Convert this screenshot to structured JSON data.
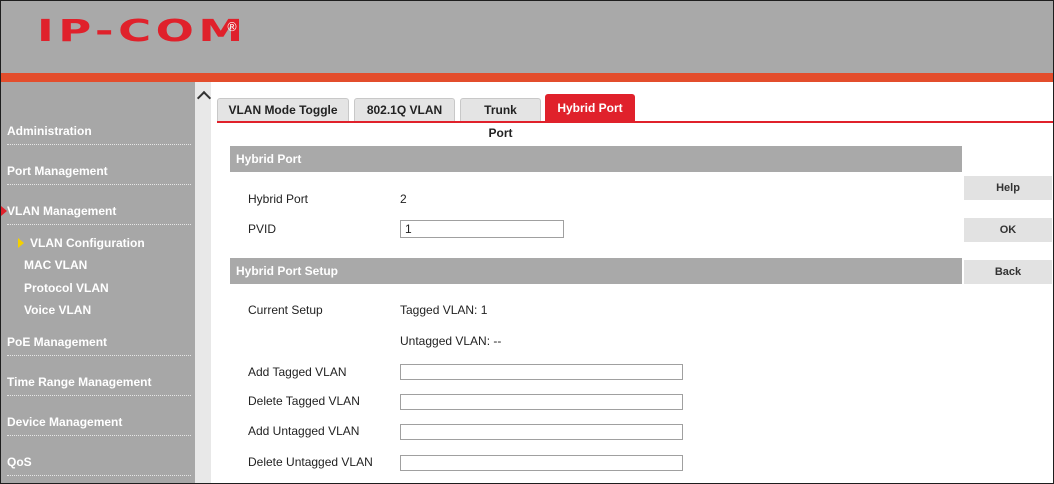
{
  "brand": {
    "logo": "IP-COM",
    "reg": "®"
  },
  "colors": {
    "accent": "#e0212b",
    "header_bg": "#a9a9a9",
    "sidebar_bg": "#a7a7a7",
    "stripe": "#e34d2c"
  },
  "sidebar": {
    "items": [
      {
        "label": "Administration"
      },
      {
        "label": "Port Management"
      },
      {
        "label": "VLAN Management"
      },
      {
        "label": "VLAN Configuration"
      },
      {
        "label": "MAC VLAN"
      },
      {
        "label": "Protocol VLAN"
      },
      {
        "label": "Voice VLAN"
      },
      {
        "label": "PoE Management"
      },
      {
        "label": "Time Range Management"
      },
      {
        "label": "Device Management"
      },
      {
        "label": "QoS"
      }
    ]
  },
  "tabs": [
    {
      "label": "VLAN Mode Toggle"
    },
    {
      "label": "802.1Q VLAN"
    },
    {
      "label": "Trunk Port"
    },
    {
      "label": "Hybrid Port"
    }
  ],
  "hybrid_port": {
    "title": "Hybrid Port",
    "port_label": "Hybrid Port",
    "port_value": "2",
    "pvid_label": "PVID",
    "pvid_value": "1"
  },
  "setup": {
    "title": "Hybrid Port Setup",
    "current_label": "Current Setup",
    "tagged_text": "Tagged VLAN: 1",
    "untagged_text": "Untagged VLAN: --",
    "add_tagged_label": "Add Tagged VLAN",
    "delete_tagged_label": "Delete Tagged VLAN",
    "add_untagged_label": "Add Untagged VLAN",
    "delete_untagged_label": "Delete Untagged VLAN",
    "add_tagged_value": "",
    "delete_tagged_value": "",
    "add_untagged_value": "",
    "delete_untagged_value": ""
  },
  "buttons": {
    "help": "Help",
    "ok": "OK",
    "back": "Back"
  }
}
